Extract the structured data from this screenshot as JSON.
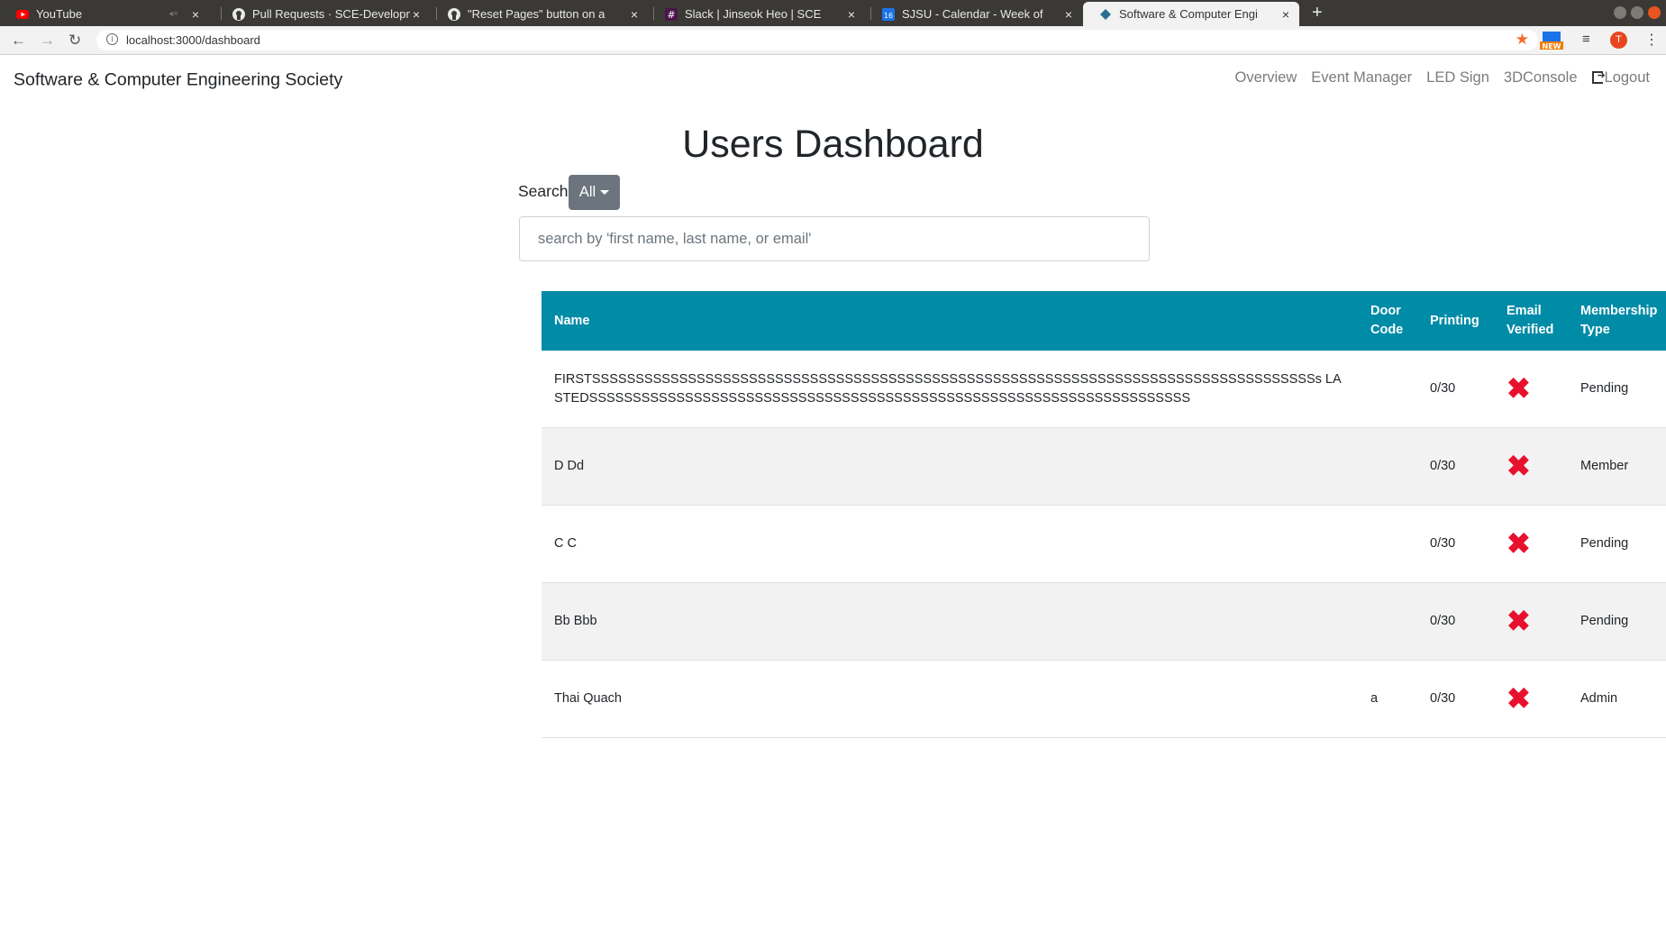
{
  "browser": {
    "tabs": [
      {
        "title": "YouTube",
        "icon": "youtube-icon",
        "active": false
      },
      {
        "title": "Pull Requests · SCE-Development",
        "icon": "github-icon",
        "active": false
      },
      {
        "title": "\"Reset Pages\" button on a",
        "icon": "github-icon",
        "active": false
      },
      {
        "title": "Slack | Jinseok Heo | SCE",
        "icon": "slack-icon",
        "active": false
      },
      {
        "title": "SJSU - Calendar - Week of",
        "icon": "calendar-icon",
        "active": false
      },
      {
        "title": "Software & Computer Engi",
        "icon": "sce-icon",
        "active": true
      }
    ],
    "url": "localhost:3000/dashboard",
    "profile_initial": "T",
    "new_badge": "NEW"
  },
  "navbar": {
    "brand": "Software & Computer Engineering Society",
    "links": [
      "Overview",
      "Event Manager",
      "LED Sign",
      "3DConsole"
    ],
    "logout": "Logout"
  },
  "page": {
    "title": "Users Dashboard",
    "search_label": "Search",
    "filter_value": "All",
    "search_placeholder": "search by 'first name, last name, or email'"
  },
  "table": {
    "headers": {
      "name": "Name",
      "door_code": "Door Code",
      "printing": "Printing",
      "email_verified": "Email Verified",
      "membership": "Membership Type"
    },
    "rows": [
      {
        "name": "FIRSTSSSSSSSSSSSSSSSSSSSSSSSSSSSSSSSSSSSSSSSSSSSSSSSSSSSSSSSSSSSSSSSSSSSSSSSSSSSSSSSSSSSs LASTEDSSSSSSSSSSSSSSSSSSSSSSSSSSSSSSSSSSSSSSSSSSSSSSSSSSSSSSSSSSSSSSSSSSSSS",
        "door_code": "",
        "printing": "0/30",
        "email_verified": "✖",
        "membership": "Pending"
      },
      {
        "name": "D Dd",
        "door_code": "",
        "printing": "0/30",
        "email_verified": "✖",
        "membership": "Member"
      },
      {
        "name": "C C",
        "door_code": "",
        "printing": "0/30",
        "email_verified": "✖",
        "membership": "Pending"
      },
      {
        "name": "Bb Bbb",
        "door_code": "",
        "printing": "0/30",
        "email_verified": "✖",
        "membership": "Pending"
      },
      {
        "name": "Thai Quach",
        "door_code": "a",
        "printing": "0/30",
        "email_verified": "✖",
        "membership": "Admin"
      }
    ]
  },
  "colors": {
    "table_header": "#008ba7",
    "filter_button": "#6c757d",
    "unverified": "#e8112d"
  }
}
